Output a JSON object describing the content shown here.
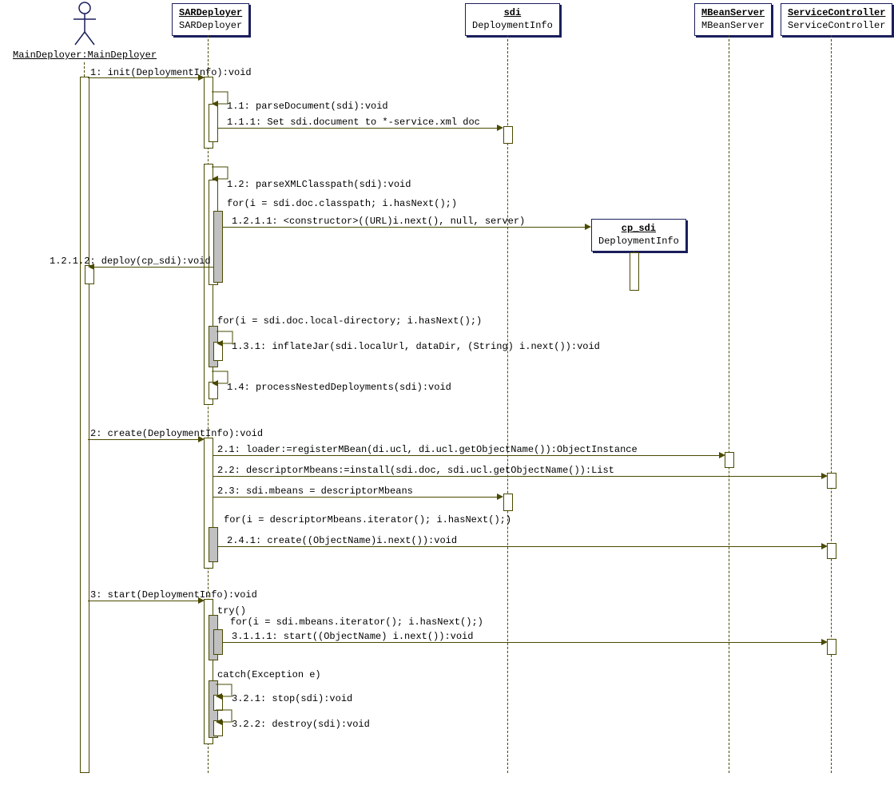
{
  "actor": {
    "label": "MainDeployer:MainDeployer"
  },
  "participants": {
    "sarDeployer": {
      "name": "SARDeployer",
      "type": "SARDeployer"
    },
    "sdi": {
      "name": "sdi",
      "type": "DeploymentInfo"
    },
    "cpSdi": {
      "name": "cp_sdi",
      "type": "DeploymentInfo"
    },
    "mbeanServer": {
      "name": "MBeanServer",
      "type": "MBeanServer"
    },
    "serviceController": {
      "name": "ServiceController",
      "type": "ServiceController"
    }
  },
  "messages": {
    "m1": "1: init(DeploymentInfo):void",
    "m1_1": "1.1: parseDocument(sdi):void",
    "m1_1_1": "1.1.1: Set sdi.document to *-service.xml doc",
    "m1_2": "1.2: parseXMLClasspath(sdi):void",
    "m1_loop1": "for(i = sdi.doc.classpath; i.hasNext();)",
    "m1_2_1_1": "1.2.1.1: <constructor>((URL)i.next(), null, server)",
    "m1_2_1_2": "1.2.1.2: deploy(cp_sdi):void",
    "m1_loop2": "for(i = sdi.doc.local-directory; i.hasNext();)",
    "m1_3_1": "1.3.1: inflateJar(sdi.localUrl, dataDir, (String) i.next()):void",
    "m1_4": "1.4: processNestedDeployments(sdi):void",
    "m2": "2: create(DeploymentInfo):void",
    "m2_1": "2.1: loader:=registerMBean(di.ucl, di.ucl.getObjectName()):ObjectInstance",
    "m2_2": "2.2: descriptorMbeans:=install(sdi.doc, sdi.ucl.getObjectName()):List",
    "m2_3": "2.3: sdi.mbeans = descriptorMbeans",
    "m2_loop": "for(i = descriptorMbeans.iterator(); i.hasNext();)",
    "m2_4_1": "2.4.1: create((ObjectName)i.next()):void",
    "m3": "3: start(DeploymentInfo):void",
    "m3_try": "try()",
    "m3_loop": "for(i = sdi.mbeans.iterator(); i.hasNext();)",
    "m3_1_1_1": "3.1.1.1: start((ObjectName) i.next()):void",
    "m3_catch": "catch(Exception e)",
    "m3_2_1": "3.2.1: stop(sdi):void",
    "m3_2_2": "3.2.2: destroy(sdi):void"
  },
  "colors": {
    "box_border": "#1a1e5c",
    "line": "#4a4a00"
  }
}
